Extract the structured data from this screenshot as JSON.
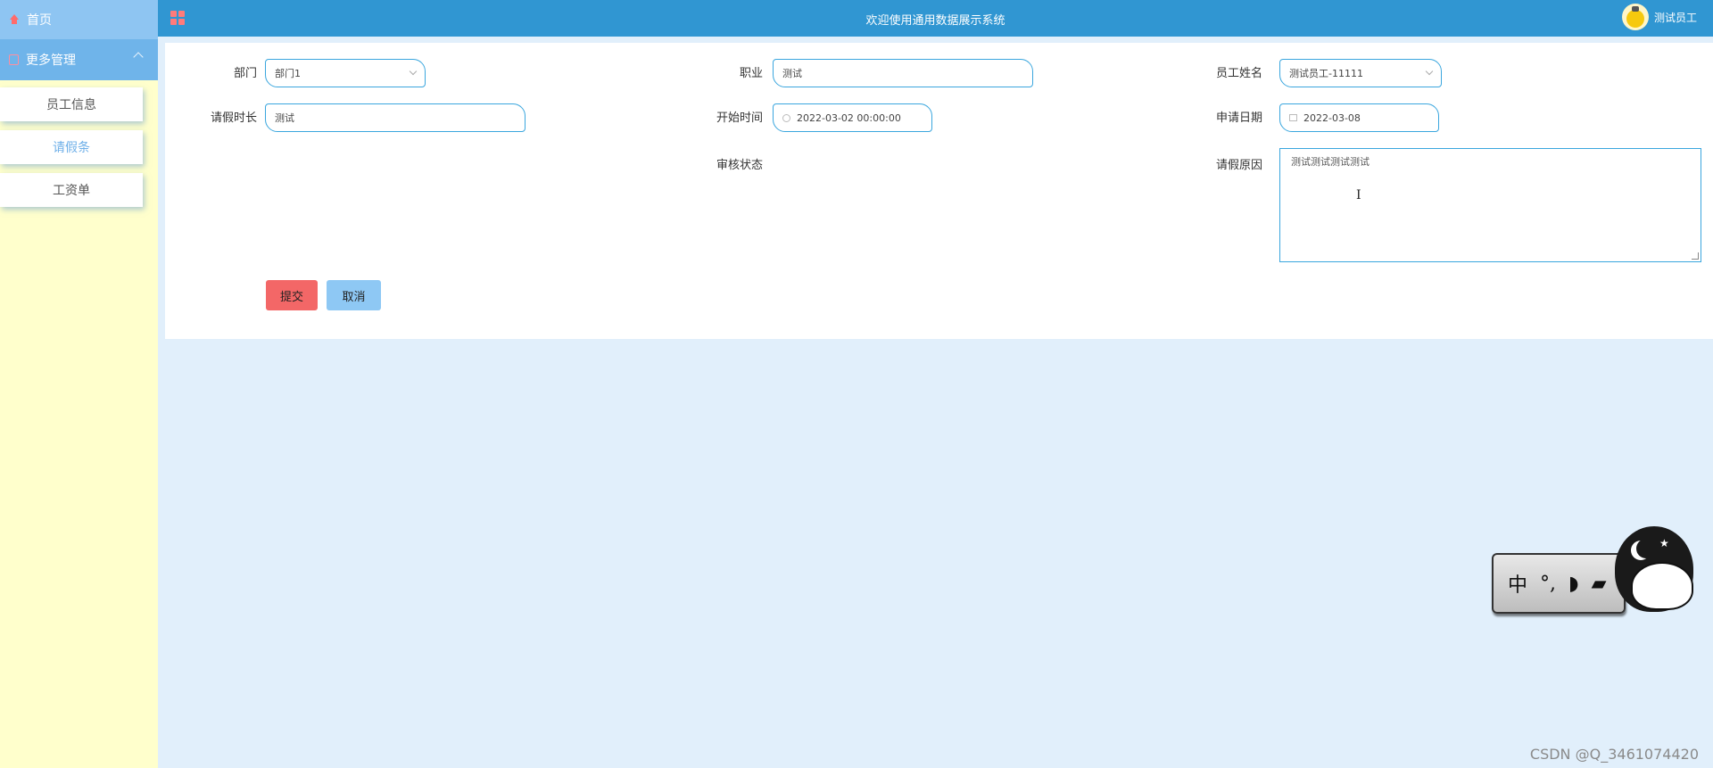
{
  "sidebar": {
    "home_label": "首页",
    "group_label": "更多管理",
    "items": [
      {
        "label": "员工信息"
      },
      {
        "label": "请假条"
      },
      {
        "label": "工资单"
      }
    ]
  },
  "header": {
    "title": "欢迎使用通用数据展示系统",
    "user_name": "测试员工"
  },
  "form": {
    "department": {
      "label": "部门",
      "value": "部门1"
    },
    "position": {
      "label": "职业",
      "value": "测试"
    },
    "employee": {
      "label": "员工姓名",
      "value": "测试员工-11111"
    },
    "duration": {
      "label": "请假时长",
      "value": "测试"
    },
    "start_time": {
      "label": "开始时间",
      "value": "2022-03-02 00:00:00"
    },
    "apply_date": {
      "label": "申请日期",
      "value": "2022-03-08"
    },
    "audit_status": {
      "label": "审核状态"
    },
    "reason": {
      "label": "请假原因",
      "value": "测试测试测试测试"
    },
    "submit_label": "提交",
    "cancel_label": "取消"
  },
  "ime": {
    "mode": "中",
    "punct": "°,"
  },
  "colors": {
    "header": "#3096d2",
    "sidebar": "#ffffcc",
    "submit": "#f36767",
    "cancel": "#8ec8f4",
    "field_border": "#3aa6de"
  },
  "watermark": "CSDN @Q_3461074420"
}
